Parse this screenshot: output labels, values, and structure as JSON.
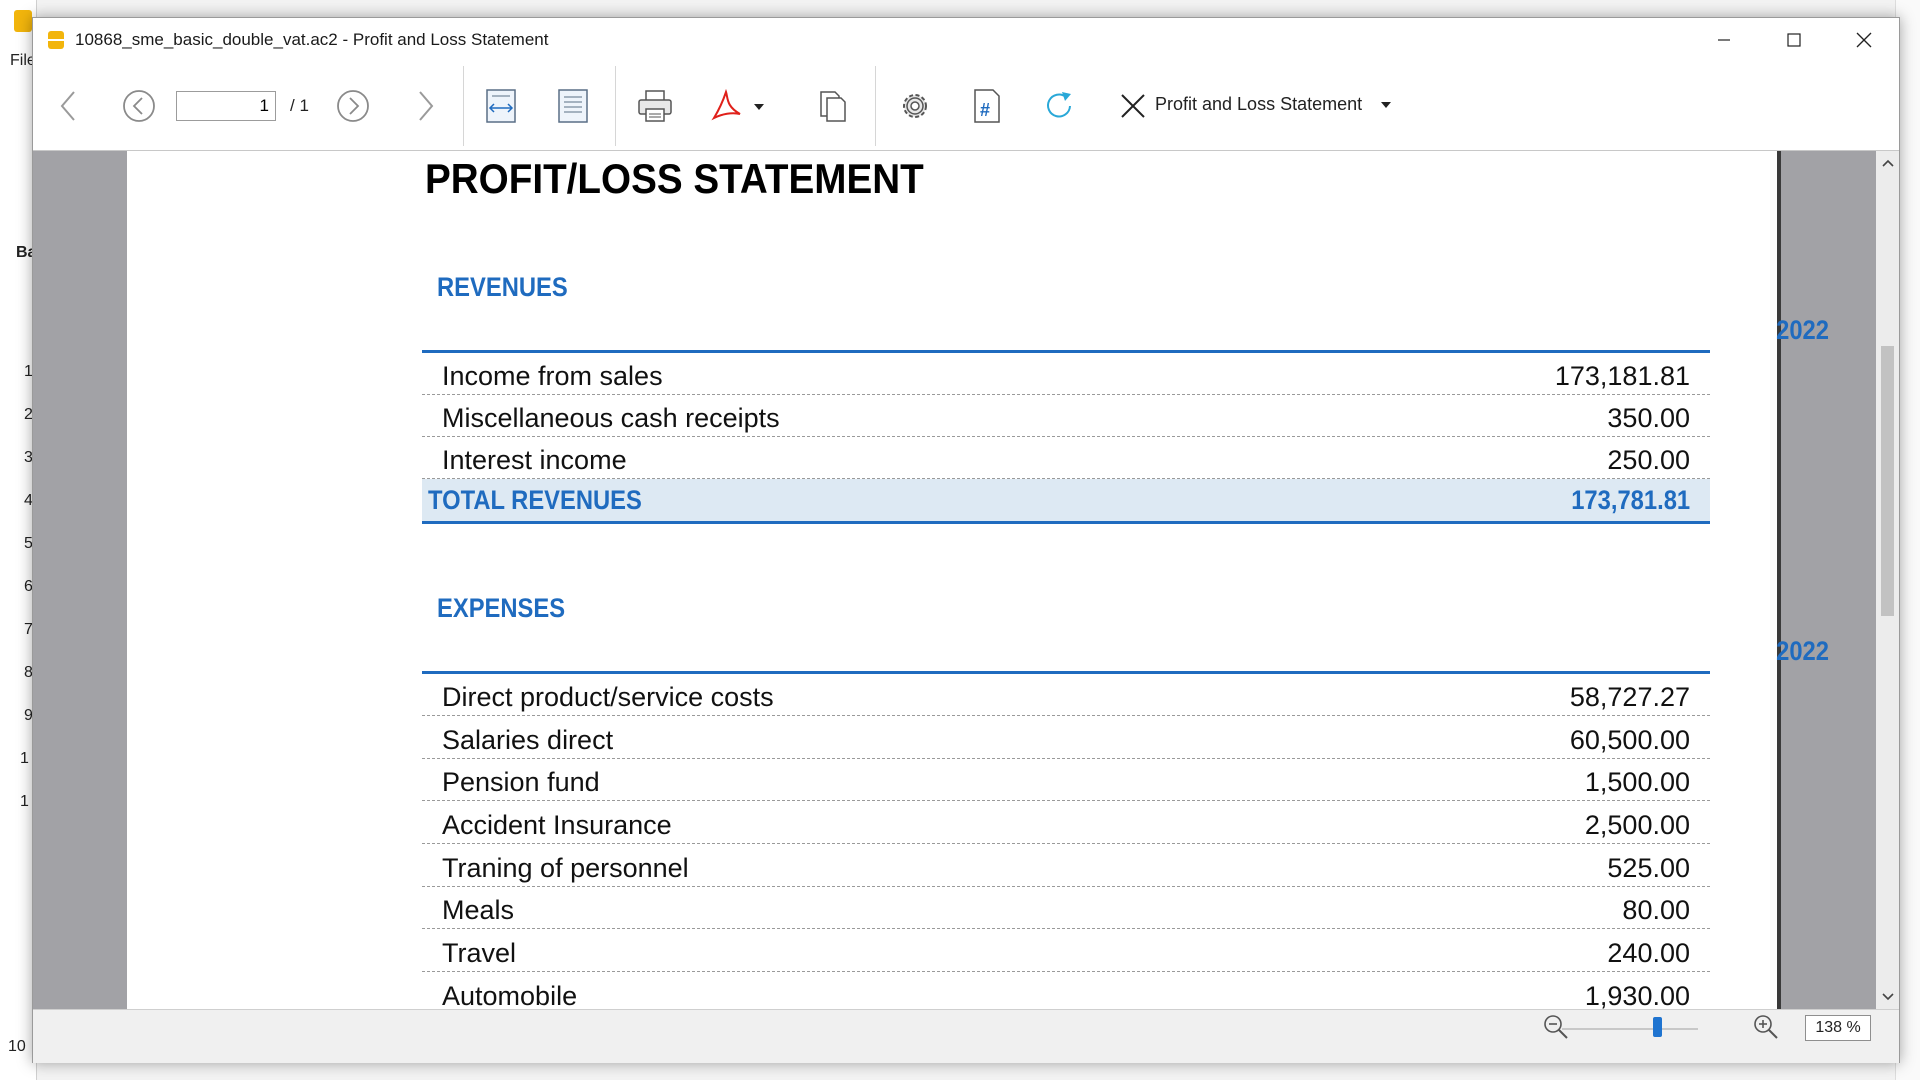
{
  "background_app": {
    "menu_file": "File",
    "side_label": "Ba",
    "row_numbers": [
      "1",
      "2",
      "3",
      "4",
      "5",
      "6",
      "7",
      "8",
      "9",
      "1",
      "1"
    ],
    "bottom_number": "10"
  },
  "window": {
    "title": "10868_sme_basic_double_vat.ac2 - Profit and Loss Statement"
  },
  "toolbar": {
    "page_current": "1",
    "page_total": "/ 1",
    "report_selector": "Profit and Loss Statement",
    "icons": [
      "back-arrow-icon",
      "previous-page-icon",
      "next-page-icon",
      "forward-arrow-icon",
      "fit-width-icon",
      "fit-page-icon",
      "print-icon",
      "pdf-icon",
      "copy-icon",
      "settings-icon",
      "page-number-icon",
      "refresh-icon",
      "close-icon"
    ]
  },
  "report": {
    "title": "PROFIT/LOSS STATEMENT",
    "revenues": {
      "heading": "REVENUES",
      "year": "2022",
      "rows": [
        {
          "label": "Income from sales",
          "amount": "173,181.81"
        },
        {
          "label": "Miscellaneous cash receipts",
          "amount": "350.00"
        },
        {
          "label": "Interest income",
          "amount": "250.00"
        }
      ],
      "total_label": "TOTAL REVENUES",
      "total_amount": "173,781.81"
    },
    "expenses": {
      "heading": "EXPENSES",
      "year": "2022",
      "rows": [
        {
          "label": "Direct product/service costs",
          "amount": "58,727.27"
        },
        {
          "label": "Salaries direct",
          "amount": "60,500.00"
        },
        {
          "label": "Pension fund",
          "amount": "1,500.00"
        },
        {
          "label": "Accident Insurance",
          "amount": "2,500.00"
        },
        {
          "label": "Traning of personnel",
          "amount": "525.00"
        },
        {
          "label": "Meals",
          "amount": "80.00"
        },
        {
          "label": "Travel",
          "amount": "240.00"
        },
        {
          "label": "Automobile",
          "amount": "1,930.00"
        }
      ]
    }
  },
  "statusbar": {
    "zoom": "138 %",
    "zoom_level_fraction": 0.7
  },
  "colors": {
    "accent_blue": "#1f6bbf",
    "total_row_bg": "#dde9f3",
    "doc_background": "#a2a2a6"
  }
}
